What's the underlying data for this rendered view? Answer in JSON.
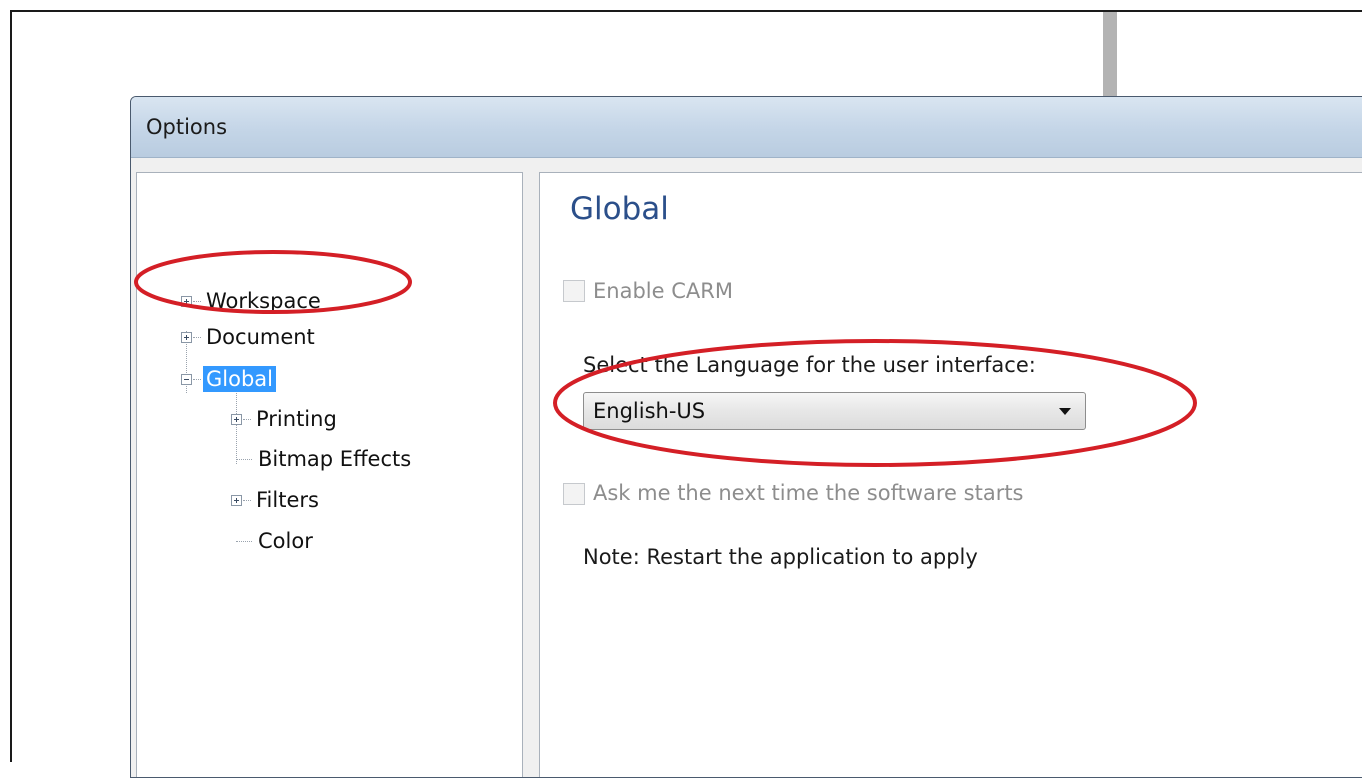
{
  "dialog": {
    "title": "Options"
  },
  "tree": {
    "items": [
      {
        "label": "Workspace",
        "expander": "plus"
      },
      {
        "label": "Document",
        "expander": "plus"
      },
      {
        "label": "Global",
        "expander": "minus",
        "selected": true
      },
      {
        "label": "Printing",
        "expander": "plus"
      },
      {
        "label": "Bitmap Effects",
        "expander": "none"
      },
      {
        "label": "Filters",
        "expander": "plus"
      },
      {
        "label": "Color",
        "expander": "none"
      }
    ]
  },
  "content": {
    "title": "Global",
    "enable_carm": {
      "label": "Enable CARM",
      "checked": false,
      "enabled": false
    },
    "language_prompt": "Select the Language for the user interface:",
    "language_select": {
      "value": "English-US"
    },
    "ask_next_time": {
      "label": "Ask me the next time the software starts",
      "checked": false,
      "enabled": false
    },
    "note": "Note: Restart the application to apply"
  },
  "colors": {
    "annotation_red": "#d41f26",
    "selection_blue": "#3399ff",
    "section_title": "#2b4f8a"
  }
}
